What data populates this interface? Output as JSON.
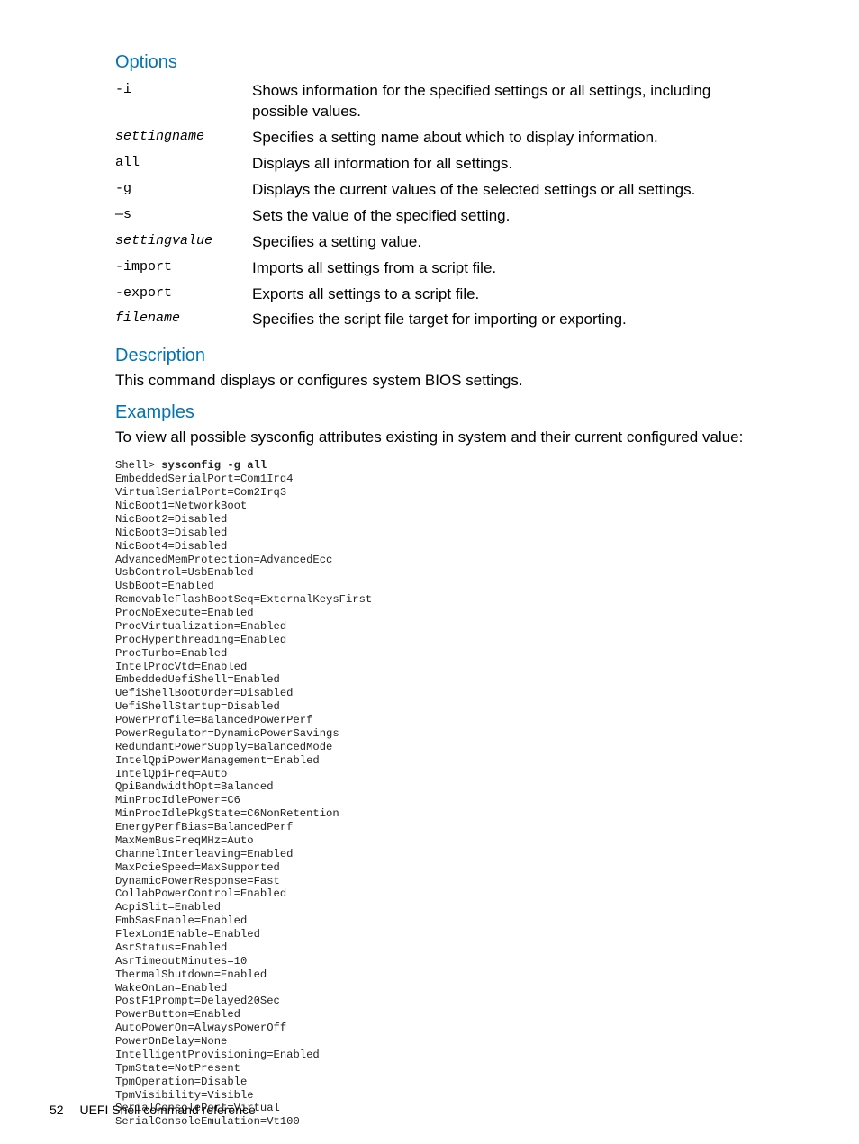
{
  "headings": {
    "options": "Options",
    "description": "Description",
    "examples": "Examples"
  },
  "options": [
    {
      "flag": "-i",
      "italic": false,
      "desc": "Shows information for the specified settings or all settings, including possible values."
    },
    {
      "flag": "settingname",
      "italic": true,
      "desc": "Specifies a setting name about which to display information."
    },
    {
      "flag": "all",
      "italic": false,
      "desc": "Displays all information for all settings."
    },
    {
      "flag": "-g",
      "italic": false,
      "desc": "Displays the current values of the selected settings or all settings."
    },
    {
      "flag": "—s",
      "italic": false,
      "desc": "Sets the value of the specified setting."
    },
    {
      "flag": "settingvalue",
      "italic": true,
      "desc": "Specifies a setting value."
    },
    {
      "flag": "-import",
      "italic": false,
      "desc": "Imports all settings from a script file."
    },
    {
      "flag": "-export",
      "italic": false,
      "desc": "Exports all settings to a script file."
    },
    {
      "flag": "filename",
      "italic": true,
      "desc": "Specifies the script file target for importing or exporting."
    }
  ],
  "description_text": "This command displays or configures system BIOS settings.",
  "examples_intro": "To view all possible sysconfig attributes existing in system and their current configured value:",
  "shell_prompt": "Shell> ",
  "shell_command": "sysconfig -g all",
  "shell_output": "EmbeddedSerialPort=Com1Irq4\nVirtualSerialPort=Com2Irq3\nNicBoot1=NetworkBoot\nNicBoot2=Disabled\nNicBoot3=Disabled\nNicBoot4=Disabled\nAdvancedMemProtection=AdvancedEcc\nUsbControl=UsbEnabled\nUsbBoot=Enabled\nRemovableFlashBootSeq=ExternalKeysFirst\nProcNoExecute=Enabled\nProcVirtualization=Enabled\nProcHyperthreading=Enabled\nProcTurbo=Enabled\nIntelProcVtd=Enabled\nEmbeddedUefiShell=Enabled\nUefiShellBootOrder=Disabled\nUefiShellStartup=Disabled\nPowerProfile=BalancedPowerPerf\nPowerRegulator=DynamicPowerSavings\nRedundantPowerSupply=BalancedMode\nIntelQpiPowerManagement=Enabled\nIntelQpiFreq=Auto\nQpiBandwidthOpt=Balanced\nMinProcIdlePower=C6\nMinProcIdlePkgState=C6NonRetention\nEnergyPerfBias=BalancedPerf\nMaxMemBusFreqMHz=Auto\nChannelInterleaving=Enabled\nMaxPcieSpeed=MaxSupported\nDynamicPowerResponse=Fast\nCollabPowerControl=Enabled\nAcpiSlit=Enabled\nEmbSasEnable=Enabled\nFlexLom1Enable=Enabled\nAsrStatus=Enabled\nAsrTimeoutMinutes=10\nThermalShutdown=Enabled\nWakeOnLan=Enabled\nPostF1Prompt=Delayed20Sec\nPowerButton=Enabled\nAutoPowerOn=AlwaysPowerOff\nPowerOnDelay=None\nIntelligentProvisioning=Enabled\nTpmState=NotPresent\nTpmOperation=Disable\nTpmVisibility=Visible\nSerialConsolePort=Virtual\nSerialConsoleEmulation=Vt100",
  "footer": {
    "page_number": "52",
    "chapter": "UEFI Shell command reference"
  }
}
